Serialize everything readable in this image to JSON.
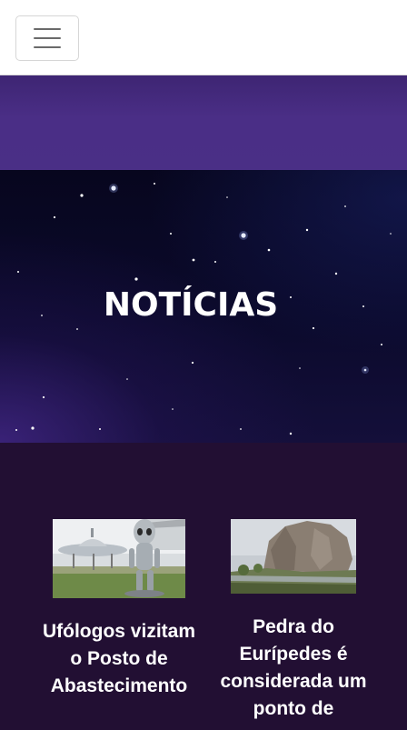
{
  "navbar": {
    "toggle_icon": "hamburger-menu-icon",
    "border_color": "#d6d6d6"
  },
  "banner": {
    "color": "#4a2e86"
  },
  "hero": {
    "title": "NOTÍCIAS",
    "background": "starry night sky"
  },
  "news": {
    "background": "#220f33",
    "items": [
      {
        "title": "Ufólogos vizitam o Posto de Abastecimento",
        "image": "alien-statue-and-flying-saucer-photo"
      },
      {
        "title": "Pedra do Eurípedes é considerada um ponto de",
        "image": "rock-formation-landscape-photo"
      }
    ]
  }
}
